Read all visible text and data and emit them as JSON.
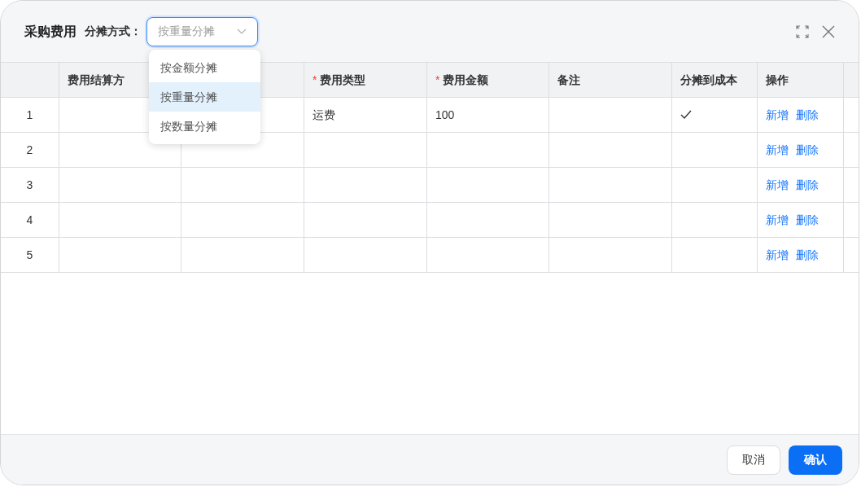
{
  "dialog": {
    "title": "采购费用",
    "field_label": "分摊方式：",
    "select": {
      "placeholder": "按重量分摊",
      "expanded": true,
      "options": [
        {
          "label": "按金额分摊",
          "selected": false
        },
        {
          "label": "按重量分摊",
          "selected": true
        },
        {
          "label": "按数量分摊",
          "selected": false
        }
      ]
    }
  },
  "table": {
    "required_mark": "*",
    "columns": [
      {
        "label": "费用结算方",
        "required": false
      },
      {
        "required": false
      },
      {
        "label": "费用类型",
        "required": true
      },
      {
        "label": "费用金额",
        "required": true
      },
      {
        "label": "备注",
        "required": false
      },
      {
        "label": "分摊到成本",
        "required": false
      },
      {
        "label": "操作",
        "required": false
      }
    ],
    "rows": [
      {
        "index": "1",
        "fee_type": "运费",
        "amount": "100",
        "allocated": true,
        "actions": [
          "新增",
          "删除"
        ]
      },
      {
        "index": "2",
        "allocated": false,
        "actions": [
          "新增",
          "删除"
        ]
      },
      {
        "index": "3",
        "allocated": false,
        "actions": [
          "新增",
          "删除"
        ]
      },
      {
        "index": "4",
        "allocated": false,
        "actions": [
          "新增",
          "删除"
        ]
      },
      {
        "index": "5",
        "allocated": false,
        "actions": [
          "新增",
          "删除"
        ]
      }
    ]
  },
  "footer": {
    "buttons": [
      {
        "label": "取消",
        "kind": "secondary"
      },
      {
        "label": "确认",
        "kind": "primary"
      }
    ]
  }
}
